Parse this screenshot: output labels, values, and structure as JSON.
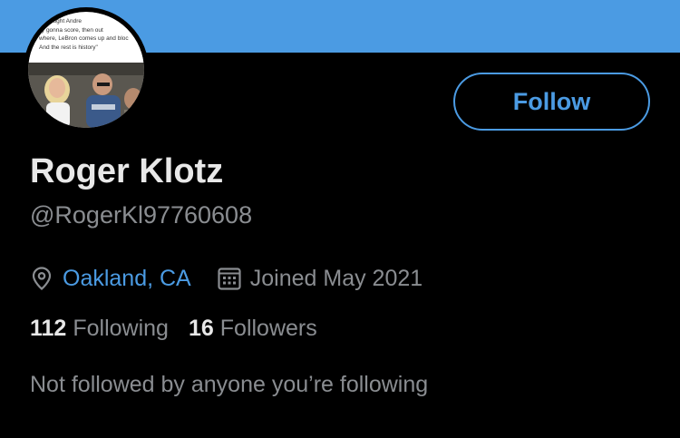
{
  "banner": {
    "color": "#4b9be3"
  },
  "avatar": {
    "caption_lines": [
      "is thought Andre",
      "lly gonna score, then out",
      "where, LeBron comes up and bloc",
      "And the rest is history\""
    ]
  },
  "profile": {
    "follow_label": "Follow",
    "name": "Roger Klotz",
    "handle": "@RogerKl97760608",
    "location": "Oakland, CA",
    "joined": "Joined May 2021",
    "following_count": "112",
    "following_label": "Following",
    "followers_count": "16",
    "followers_label": "Followers",
    "followed_by_note": "Not followed by anyone you’re following"
  },
  "icons": {
    "location": "location-pin-icon",
    "joined": "calendar-icon"
  },
  "colors": {
    "accent": "#4b9be3",
    "background": "#000000",
    "primary_text": "#e8e8e8",
    "secondary_text": "#8a8d91"
  }
}
